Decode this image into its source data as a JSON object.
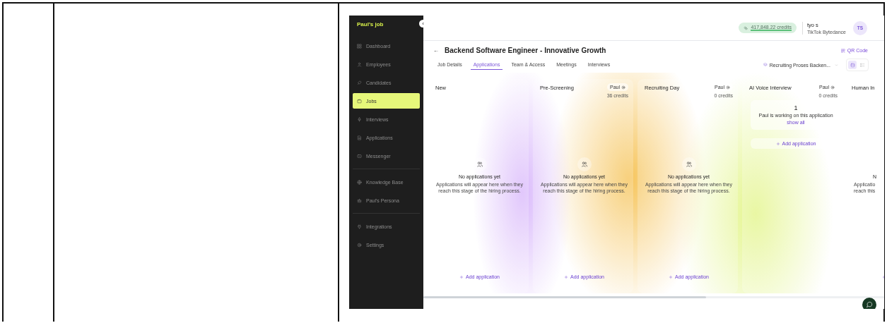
{
  "sidebar": {
    "brand": "Paul's job",
    "collapse": "‹",
    "groups": [
      {
        "items": [
          {
            "label": "Dashboard",
            "selected": false
          },
          {
            "label": "Employees",
            "selected": false
          },
          {
            "label": "Candidates",
            "selected": false
          },
          {
            "label": "Jobs",
            "selected": true
          },
          {
            "label": "Interviews",
            "selected": false
          },
          {
            "label": "Applications",
            "selected": false
          },
          {
            "label": "Messenger",
            "selected": false
          }
        ]
      },
      {
        "items": [
          {
            "label": "Knowledge Base",
            "selected": false
          },
          {
            "label": "Paul's Persona",
            "selected": false
          }
        ]
      },
      {
        "items": [
          {
            "label": "Integrations",
            "selected": false
          },
          {
            "label": "Settings",
            "selected": false
          }
        ]
      }
    ]
  },
  "header": {
    "credits": "417,848.22 credits",
    "user_name": "tyo s",
    "company": "TikTok Bytedance",
    "avatar": "TS"
  },
  "job": {
    "back": "←",
    "title": "Backend Software Engineer - Innovative Growth",
    "qr_code": "QR Code"
  },
  "tabs": [
    {
      "label": "Job Details",
      "selected": false
    },
    {
      "label": "Applications",
      "selected": true
    },
    {
      "label": "Team & Access",
      "selected": false
    },
    {
      "label": "Meetings",
      "selected": false
    },
    {
      "label": "Interviews",
      "selected": false
    }
  ],
  "pipeline": {
    "label": "Recruiting Proses Backen...",
    "views": [
      {
        "kind": "board",
        "selected": true
      },
      {
        "kind": "list",
        "selected": false
      }
    ]
  },
  "columns": [
    {
      "kind": "empty",
      "title": "New",
      "empty_title": "No applications yet",
      "empty_lines": [
        "Applications will appear here when they",
        "reach this stage of the hiring process."
      ],
      "add": "Add application"
    },
    {
      "kind": "empty",
      "title": "Pre-Screening",
      "agent": "Paul",
      "credits": "36 credits",
      "empty_title": "No applications yet",
      "empty_lines": [
        "Applications will appear here when they",
        "reach this stage of the hiring process."
      ],
      "add": "Add application"
    },
    {
      "kind": "empty",
      "title": "Recruiting Day",
      "agent": "Paul",
      "credits": "0 credits",
      "empty_title": "No applications yet",
      "empty_lines": [
        "Applications will appear here when they",
        "reach this stage of the hiring process."
      ],
      "add": "Add application"
    },
    {
      "kind": "working",
      "title": "AI Voice Interview",
      "agent": "Paul",
      "credits": "0 credits",
      "count": "1",
      "note": "Paul is working on this application",
      "show_all": "show all",
      "add": "Add application"
    },
    {
      "kind": "clipped",
      "title": "Human In",
      "empty_title": "N",
      "empty_lines": [
        "Applicatio",
        "reach this"
      ]
    }
  ]
}
